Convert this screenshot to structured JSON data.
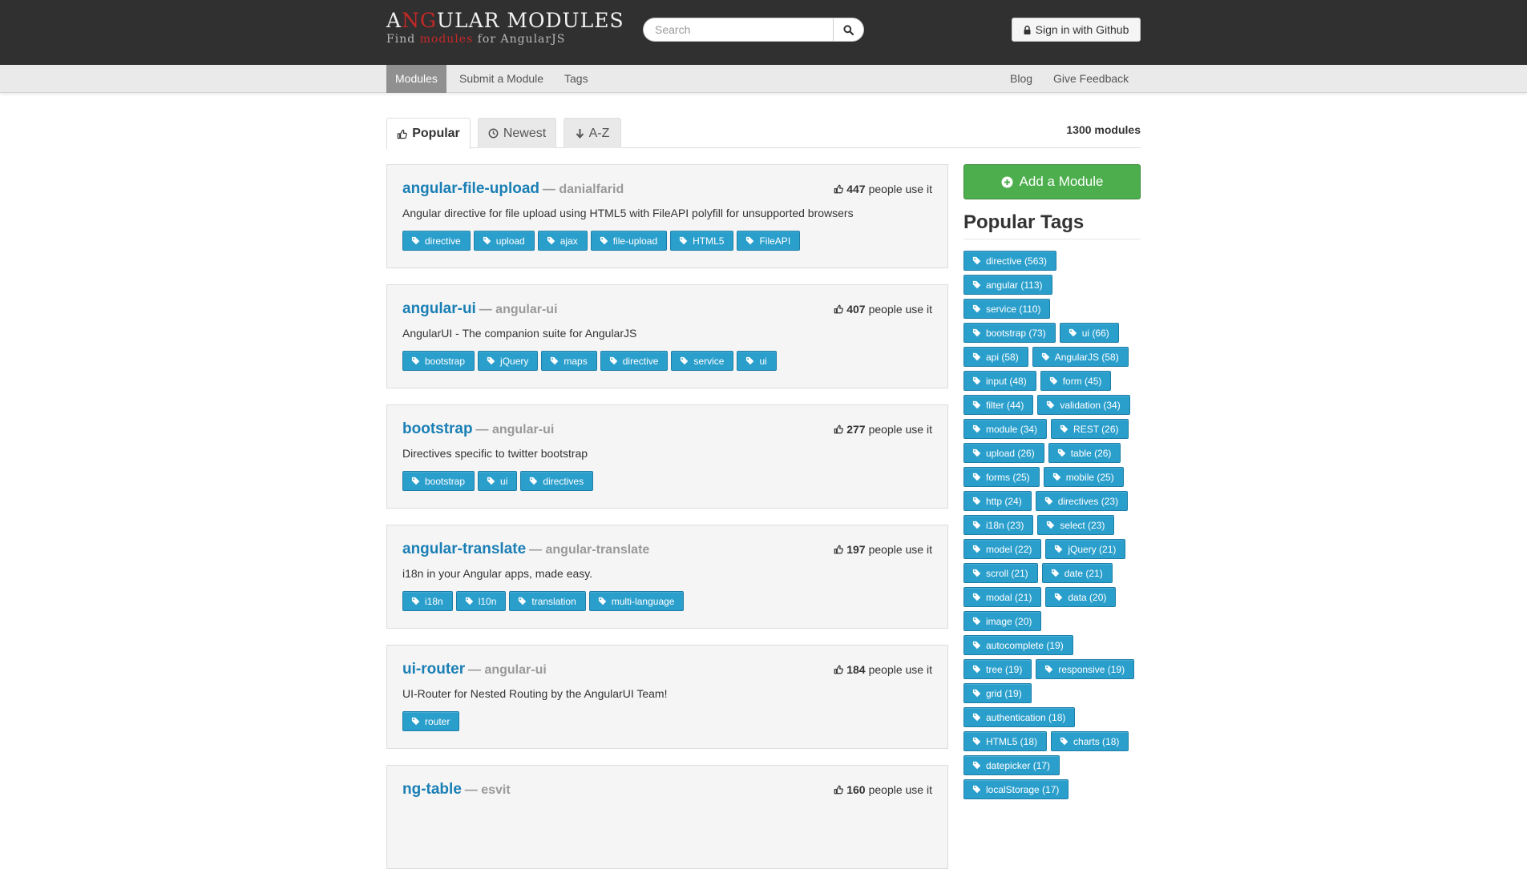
{
  "header": {
    "logo_title_1": "A",
    "logo_title_2": "NG",
    "logo_title_3": "ULAR MODULES",
    "logo_sub_1": "Find ",
    "logo_sub_2": "modules",
    "logo_sub_3": " for AngularJS",
    "search_placeholder": "Search",
    "signin_label": "Sign in with Github"
  },
  "nav": {
    "modules": "Modules",
    "submit": "Submit a Module",
    "tags": "Tags",
    "blog": "Blog",
    "feedback": "Give Feedback"
  },
  "sort_tabs": {
    "popular": "Popular",
    "newest": "Newest",
    "az": "A-Z"
  },
  "module_count": "1300 modules",
  "users_suffix": "people use it",
  "modules": [
    {
      "name": "angular-file-upload",
      "author": "— danialfarid",
      "users": "447",
      "description": "Angular directive for file upload using HTML5 with FileAPI polyfill for unsupported browsers",
      "tags": [
        "directive",
        "upload",
        "ajax",
        "file-upload",
        "HTML5",
        "FileAPI"
      ]
    },
    {
      "name": "angular-ui",
      "author": "— angular-ui",
      "users": "407",
      "description": "AngularUI - The companion suite for AngularJS",
      "tags": [
        "bootstrap",
        "jQuery",
        "maps",
        "directive",
        "service",
        "ui"
      ]
    },
    {
      "name": "bootstrap",
      "author": "— angular-ui",
      "users": "277",
      "description": "Directives specific to twitter bootstrap",
      "tags": [
        "bootstrap",
        "ui",
        "directives"
      ]
    },
    {
      "name": "angular-translate",
      "author": "— angular-translate",
      "users": "197",
      "description": "i18n in your Angular apps, made easy.",
      "tags": [
        "i18n",
        "l10n",
        "translation",
        "multi-language"
      ]
    },
    {
      "name": "ui-router",
      "author": "— angular-ui",
      "users": "184",
      "description": "UI-Router for Nested Routing by the AngularUI Team!",
      "tags": [
        "router"
      ]
    },
    {
      "name": "ng-table",
      "author": "— esvit",
      "users": "160",
      "description": "",
      "tags": []
    }
  ],
  "sidebar": {
    "add_module": "Add a Module",
    "popular_tags_heading": "Popular Tags",
    "tag_rows": [
      [
        "directive (563)"
      ],
      [
        "angular (113)"
      ],
      [
        "service (110)"
      ],
      [
        "bootstrap (73)",
        "ui (66)"
      ],
      [
        "api (58)",
        "AngularJS (58)"
      ],
      [
        "input (48)",
        "form (45)"
      ],
      [
        "filter (44)",
        "validation (34)"
      ],
      [
        "module (34)",
        "REST (26)"
      ],
      [
        "upload (26)",
        "table (26)"
      ],
      [
        "forms (25)",
        "mobile (25)"
      ],
      [
        "http (24)",
        "directives (23)"
      ],
      [
        "i18n (23)",
        "select (23)"
      ],
      [
        "model (22)",
        "jQuery (21)"
      ],
      [
        "scroll (21)",
        "date (21)"
      ],
      [
        "modal (21)",
        "data (20)"
      ],
      [
        "image (20)"
      ],
      [
        "autocomplete (19)"
      ],
      [
        "tree (19)",
        "responsive (19)"
      ],
      [
        "grid (19)"
      ],
      [
        "authentication (18)"
      ],
      [
        "HTML5 (18)",
        "charts (18)"
      ],
      [
        "datepicker (17)"
      ],
      [
        "localStorage (17)"
      ]
    ]
  }
}
